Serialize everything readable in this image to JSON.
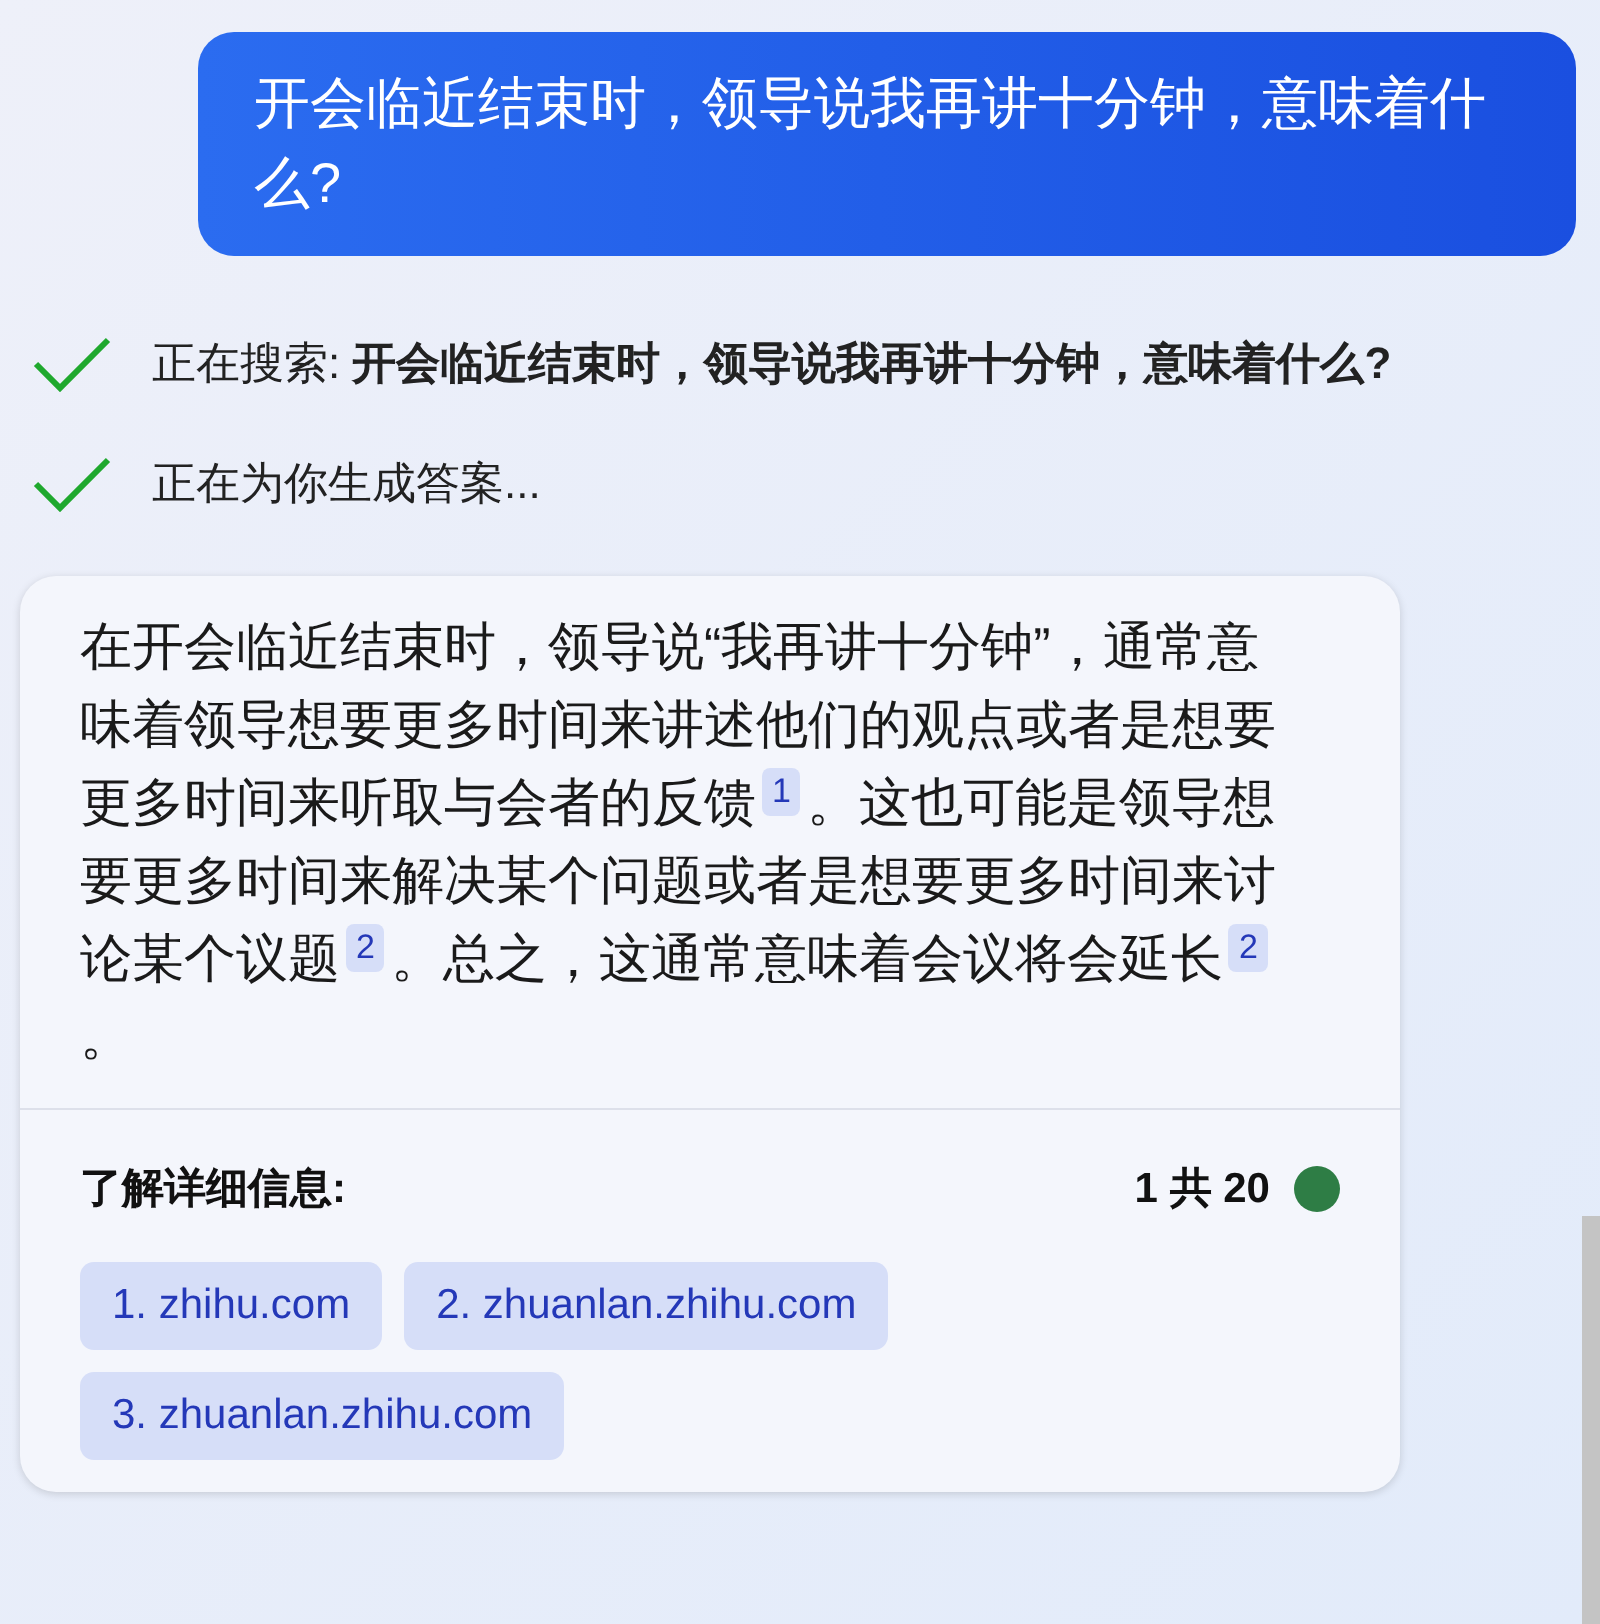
{
  "user_message": "开会临近结束时，领导说我再讲十分钟，意味着什么?",
  "steps": [
    {
      "label": "正在搜索: **开会临近结束时，领导说我再讲十分钟，意味着什么?**",
      "done": true
    },
    {
      "label": "正在为你生成答案...",
      "done": true
    }
  ],
  "answer": {
    "segments": [
      {
        "text": "在开会临近结束时，领导说“我再讲十分钟”，通常意味着领导想要更多时间来讲述他们的观点或者是想要更多时间来听取与会者的反馈",
        "citation": "1"
      },
      {
        "text": "。这也可能是领导想要更多时间来解决某个问题或者是想要更多时间来讨论某个议题",
        "citation": "2"
      },
      {
        "text": "。总之，这通常意味着会议将会延长",
        "citation": "2"
      },
      {
        "text": "。"
      }
    ],
    "learn_more": {
      "title": "了解详细信息:",
      "count": "1 共 20",
      "status_dot": {
        "color": "#2e7d45"
      },
      "links": [
        "1. zhihu.com",
        "2. zhuanlan.zhihu.com",
        "3. zhuanlan.zhihu.com"
      ]
    }
  }
}
